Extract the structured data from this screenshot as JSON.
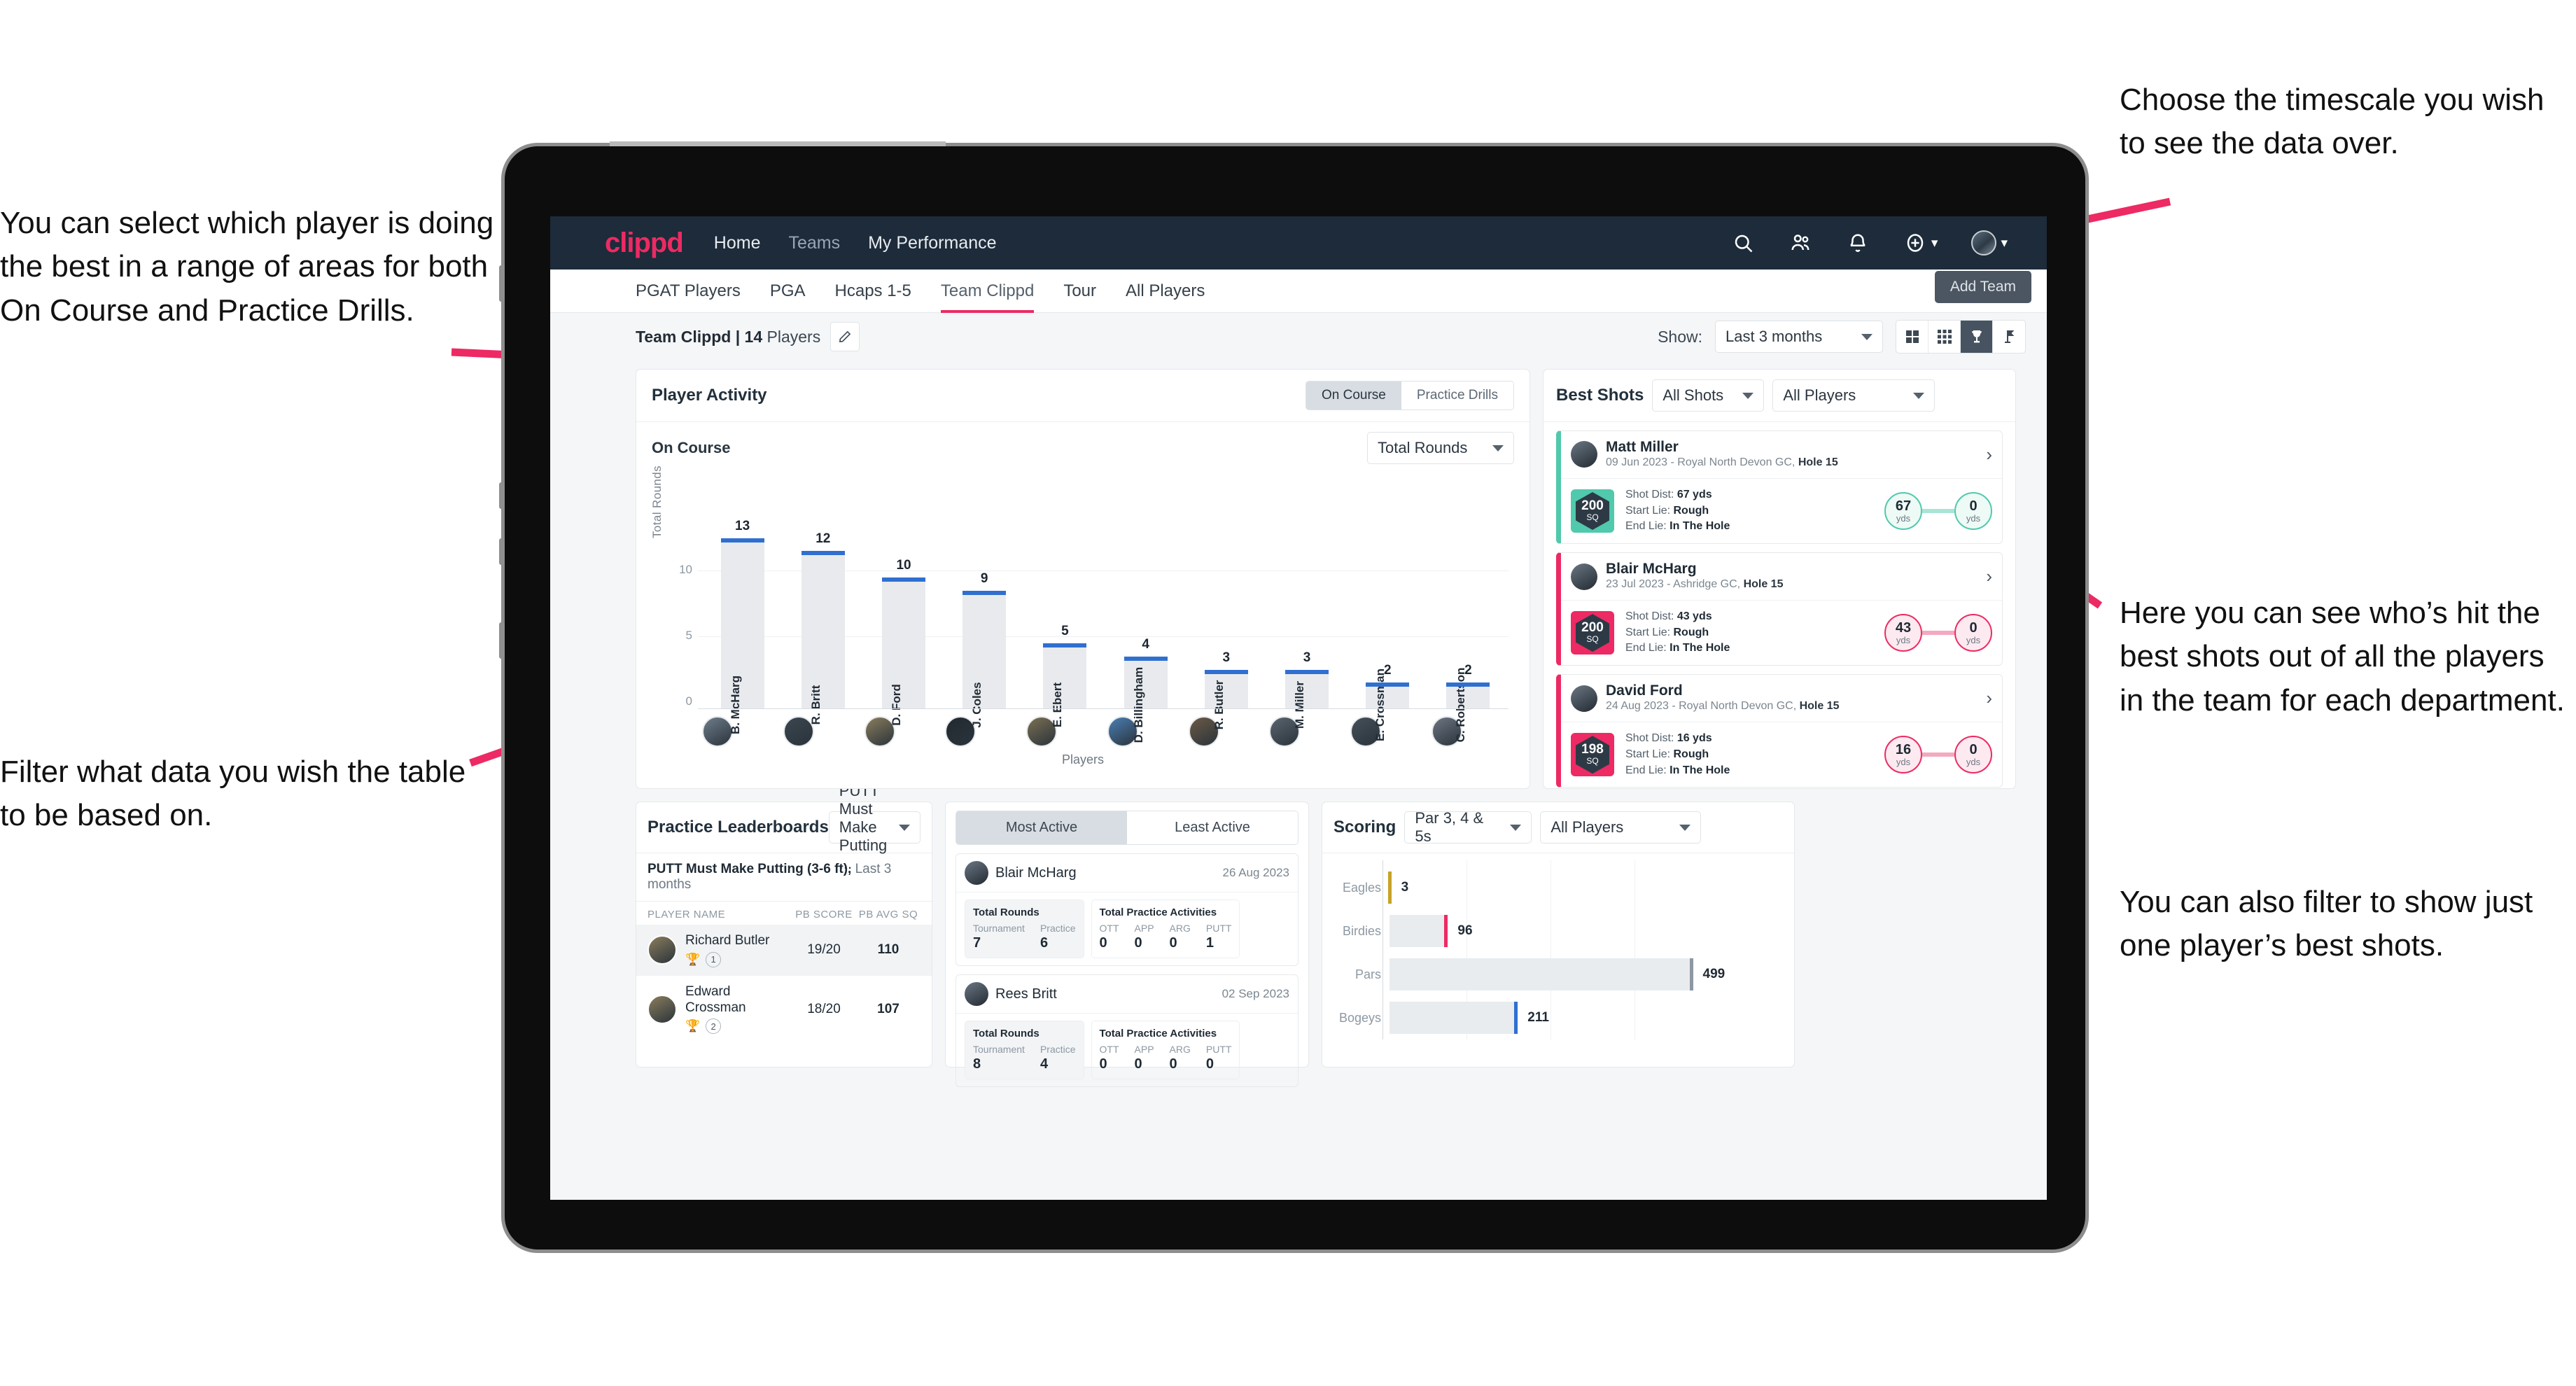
{
  "annotations": {
    "left_top": "You can select which player is doing the best in a range of areas for both On Course and Practice Drills.",
    "left_bottom": "Filter what data you wish the table to be based on.",
    "right_top": "Choose the timescale you wish to see the data over.",
    "right_middle": "Here you can see who’s hit the best shots out of all the players in the team for each department.",
    "right_bottom": "You can also filter to show just one player’s best shots."
  },
  "topnav": {
    "brand": "clippd",
    "links": [
      "Home",
      "Teams",
      "My Performance"
    ],
    "icons": [
      "search-icon",
      "people-icon",
      "bell-icon",
      "plus-circle-icon",
      "avatar-icon"
    ]
  },
  "tabs": [
    {
      "label": "PGAT Players",
      "active": false
    },
    {
      "label": "PGA",
      "active": false
    },
    {
      "label": "Hcaps 1-5",
      "active": false
    },
    {
      "label": "Team Clippd",
      "active": true
    },
    {
      "label": "Tour",
      "active": false
    },
    {
      "label": "All Players",
      "active": false
    }
  ],
  "tooltip": {
    "add_team": "Add Team"
  },
  "subbar": {
    "team_name": "Team Clippd",
    "team_sep": " | ",
    "player_count": "14",
    "players_word": " Players",
    "show_label": "Show:",
    "timescale_value": "Last 3 months",
    "view_buttons": [
      "grid-large-icon",
      "grid-small-icon",
      "trophy-icon",
      "flag-icon"
    ],
    "view_active_index": 2
  },
  "player_activity": {
    "title": "Player Activity",
    "segments": [
      {
        "label": "On Course",
        "active": true
      },
      {
        "label": "Practice Drills",
        "active": false
      }
    ],
    "sub_label": "On Course",
    "metric_select": "Total Rounds",
    "x_axis_title": "Players"
  },
  "chart_data": {
    "type": "bar",
    "title": "Player Activity",
    "xlabel": "Players",
    "ylabel": "Total Rounds",
    "ylim": [
      0,
      15
    ],
    "yticks": [
      0,
      5,
      10
    ],
    "grid": true,
    "categories": [
      "B. McHarg",
      "R. Britt",
      "D. Ford",
      "J. Coles",
      "E. Ebert",
      "D. Billingham",
      "R. Butler",
      "M. Miller",
      "E. Crossman",
      "C. Robertson"
    ],
    "values": [
      13,
      12,
      10,
      9,
      5,
      4,
      3,
      3,
      2,
      2
    ]
  },
  "best_shots": {
    "title": "Best Shots",
    "shot_filter": "All Shots",
    "player_filter": "All Players",
    "cards": [
      {
        "player": "Matt Miller",
        "meta_date": "09 Jun 2023 - Royal North Devon GC, ",
        "meta_hole": "Hole 15",
        "badge_value": "200",
        "badge_unit": "SQ",
        "accent": "#51c9ac",
        "shot_dist_label": "Shot Dist: ",
        "shot_dist": "67 yds",
        "start_lie_label": "Start Lie: ",
        "start_lie": "Rough",
        "end_lie_label": "End Lie: ",
        "end_lie": "In The Hole",
        "from_value": "67",
        "from_unit": "yds",
        "to_value": "0",
        "to_unit": "yds"
      },
      {
        "player": "Blair McHarg",
        "meta_date": "23 Jul 2023 - Ashridge GC, ",
        "meta_hole": "Hole 15",
        "badge_value": "200",
        "badge_unit": "SQ",
        "accent": "#ed2a63",
        "shot_dist_label": "Shot Dist: ",
        "shot_dist": "43 yds",
        "start_lie_label": "Start Lie: ",
        "start_lie": "Rough",
        "end_lie_label": "End Lie: ",
        "end_lie": "In The Hole",
        "from_value": "43",
        "from_unit": "yds",
        "to_value": "0",
        "to_unit": "yds"
      },
      {
        "player": "David Ford",
        "meta_date": "24 Aug 2023 - Royal North Devon GC, ",
        "meta_hole": "Hole 15",
        "badge_value": "198",
        "badge_unit": "SQ",
        "accent": "#ed2a63",
        "shot_dist_label": "Shot Dist: ",
        "shot_dist": "16 yds",
        "start_lie_label": "Start Lie: ",
        "start_lie": "Rough",
        "end_lie_label": "End Lie: ",
        "end_lie": "In The Hole",
        "from_value": "16",
        "from_unit": "yds",
        "to_value": "0",
        "to_unit": "yds"
      }
    ]
  },
  "practice_leaderboards": {
    "title": "Practice Leaderboards",
    "drill_select": "PUTT Must Make Putting ...",
    "subtitle_bold": "PUTT Must Make Putting (3-6 ft),",
    "subtitle_rest": " Last 3 months",
    "columns": [
      "PLAYER NAME",
      "PB SCORE",
      "PB AVG SQ"
    ],
    "rows": [
      {
        "name": "Richard Butler",
        "rank": "1",
        "trophy": "gold",
        "pb_score": "19/20",
        "pb_avg_sq": "110",
        "highlight": true
      },
      {
        "name": "Edward Crossman",
        "rank": "2",
        "trophy": "silver",
        "pb_score": "18/20",
        "pb_avg_sq": "107",
        "highlight": false
      }
    ]
  },
  "activity": {
    "tabs": [
      {
        "label": "Most Active",
        "active": true
      },
      {
        "label": "Least Active",
        "active": false
      }
    ],
    "rounds_title": "Total Rounds",
    "rounds_keys": [
      "Tournament",
      "Practice"
    ],
    "practice_title": "Total Practice Activities",
    "practice_keys": [
      "OTT",
      "APP",
      "ARG",
      "PUTT"
    ],
    "cards": [
      {
        "name": "Blair McHarg",
        "date": "26 Aug 2023",
        "rounds": [
          "7",
          "6"
        ],
        "practice": [
          "0",
          "0",
          "0",
          "1"
        ]
      },
      {
        "name": "Rees Britt",
        "date": "02 Sep 2023",
        "rounds": [
          "8",
          "4"
        ],
        "practice": [
          "0",
          "0",
          "0",
          "0"
        ]
      }
    ]
  },
  "scoring": {
    "title": "Scoring",
    "par_select": "Par 3, 4 & 5s",
    "player_select": "All Players"
  },
  "scoring_chart": {
    "type": "bar",
    "orientation": "horizontal",
    "title": "Scoring",
    "categories": [
      "Eagles",
      "Birdies",
      "Pars",
      "Bogeys"
    ],
    "values": [
      3,
      96,
      499,
      211
    ],
    "colors": [
      "#c9a227",
      "#ed2a63",
      "#8d98a2",
      "#2f6fd0"
    ],
    "xlim": [
      0,
      640
    ],
    "grid": true
  },
  "colors": {
    "brand_pink": "#ed2a63",
    "nav_dark": "#1d2b3a",
    "teal": "#51c9ac",
    "blue": "#2f6fd0",
    "gold": "#c9a227"
  }
}
